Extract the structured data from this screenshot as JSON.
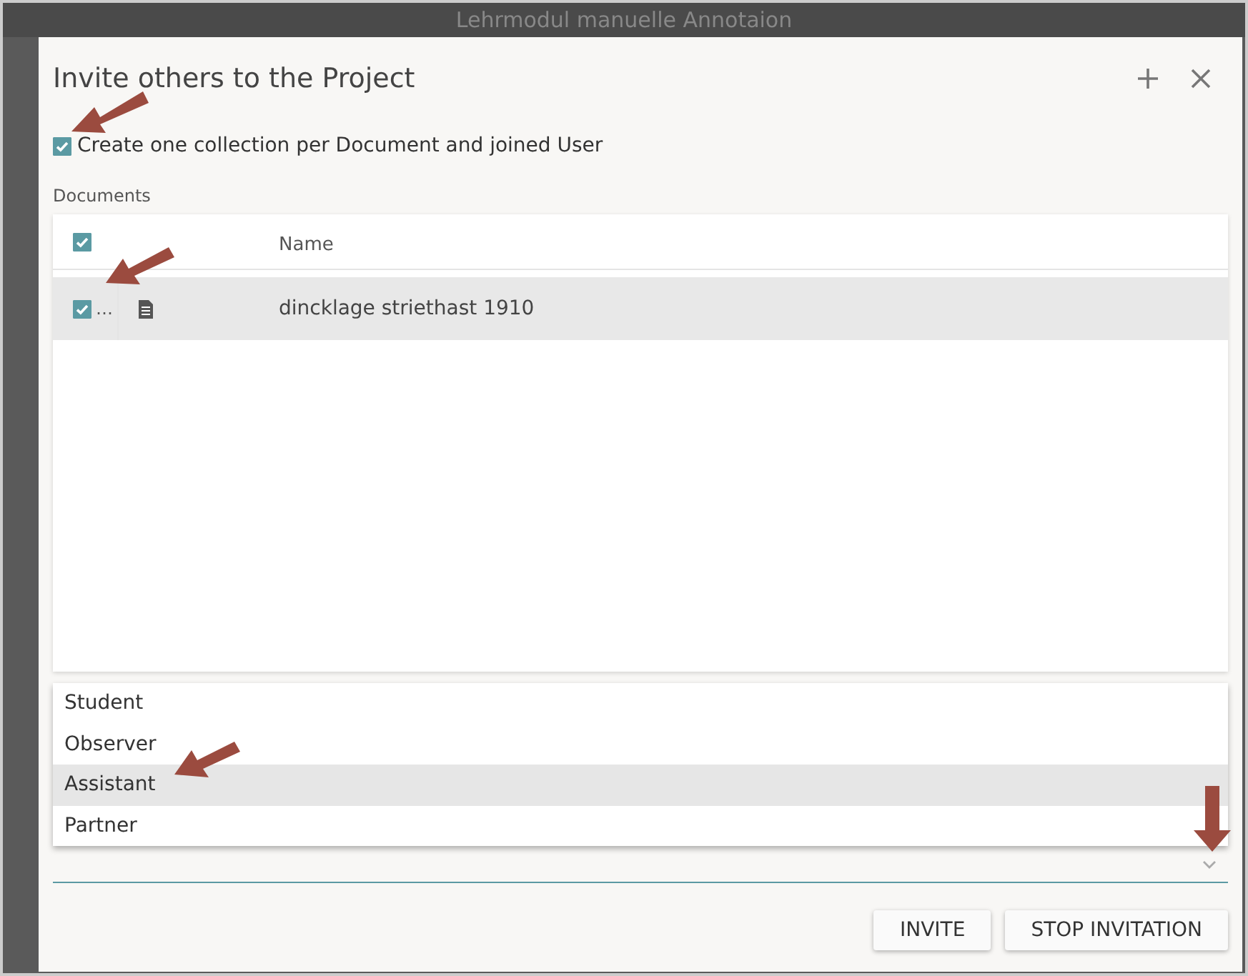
{
  "background": {
    "title": "Lehrmodul manuelle Annotaion"
  },
  "dialog": {
    "title": "Invite others to the Project",
    "collection_option": {
      "label": "Create one collection per Document and joined User",
      "checked": true
    },
    "documents": {
      "label": "Documents",
      "select_all_checked": true,
      "columns": [
        "Name"
      ],
      "rows": [
        {
          "name": "dincklage striethast 1910",
          "more": "…",
          "checked": true,
          "selected": true
        }
      ]
    },
    "role_options": [
      {
        "label": "Student",
        "selected": false
      },
      {
        "label": "Observer",
        "selected": false
      },
      {
        "label": "Assistant",
        "selected": true
      },
      {
        "label": "Partner",
        "selected": false
      }
    ],
    "buttons": [
      "INVITE",
      "STOP INVITATION"
    ]
  }
}
